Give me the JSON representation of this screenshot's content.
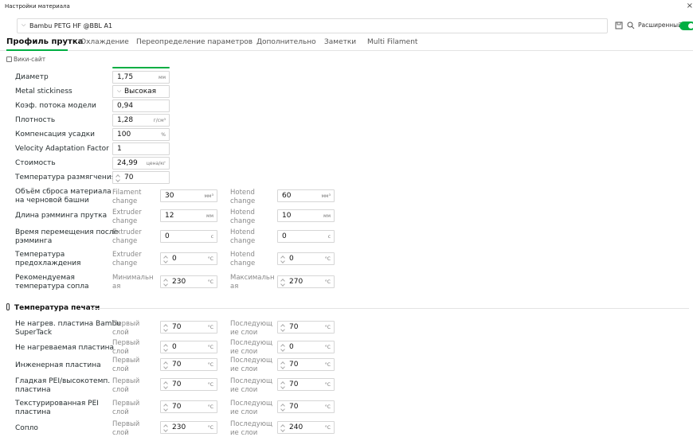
{
  "window": {
    "title": "Настройки материала",
    "close": "×"
  },
  "preset": {
    "name": "Bambu PETG HF @BBL A1",
    "chevron": "⌵"
  },
  "toolbar": {
    "save_icon": "save-icon",
    "search_icon": "search-icon",
    "advanced_label": "Расширенный",
    "advanced_on": true,
    "accent": "#00ae42"
  },
  "tabs": [
    {
      "label": "Профиль прутка",
      "active": true
    },
    {
      "label": "Охлаждение"
    },
    {
      "label": "Переопределение параметров"
    },
    {
      "label": "Дополнительно"
    },
    {
      "label": "Заметки"
    },
    {
      "label": "Multi Filament"
    }
  ],
  "wiki": "Вики-сайт",
  "basic": {
    "diameter": {
      "label": "Диаметр",
      "value": "1,75",
      "unit": "мм"
    },
    "stickiness": {
      "label": "Metal stickiness",
      "value": "Высокая"
    },
    "flow": {
      "label": "Коэф. потока модели",
      "value": "0,94"
    },
    "density": {
      "label": "Плотность",
      "value": "1,28",
      "unit": "г/см³"
    },
    "shrink": {
      "label": "Компенсация усадки",
      "value": "100",
      "unit": "%"
    },
    "velocity": {
      "label": "Velocity Adaptation Factor",
      "value": "1"
    },
    "cost": {
      "label": "Стоимость",
      "value": "24,99",
      "unit": "цена/кг"
    },
    "soften": {
      "label": "Температура размягчения",
      "value": "70"
    }
  },
  "changes": {
    "purge": {
      "label1": "Объём сброса материала",
      "label2": "на черновой башни",
      "sub1a": "Filament",
      "sub1b": "change",
      "value1": "30",
      "unit1": "мм³",
      "sub2a": "Hotend",
      "sub2b": "change",
      "value2": "60",
      "unit2": "мм³"
    },
    "ram_len": {
      "label": "Длина рэмминга прутка",
      "sub1a": "Extruder",
      "sub1b": "change",
      "value1": "12",
      "unit1": "мм",
      "sub2a": "Hotend",
      "sub2b": "change",
      "value2": "10",
      "unit2": "мм"
    },
    "ram_time": {
      "label1": "Время перемещения после",
      "label2": "рэмминга",
      "sub1a": "Extruder",
      "sub1b": "change",
      "value1": "0",
      "unit1": "с",
      "sub2a": "Hotend",
      "sub2b": "change",
      "value2": "0",
      "unit2": "с"
    },
    "precool": {
      "label1": "Температура",
      "label2": "предохлаждения",
      "sub1a": "Extruder",
      "sub1b": "change",
      "value1": "0",
      "unit1": "°C",
      "sub2a": "Hotend",
      "sub2b": "change",
      "value2": "0",
      "unit2": "°C"
    },
    "nozzle_rec": {
      "label1": "Рекомендуемая",
      "label2": "температура сопла",
      "sub1a": "Минимальн",
      "sub1b": "ая",
      "value1": "230",
      "unit1": "°C",
      "sub2a": "Максимальн",
      "sub2b": "ая",
      "value2": "270",
      "unit2": "°C"
    }
  },
  "print_temp": {
    "title": "Температура печати",
    "sub_first_a": "Первый",
    "sub_first_b": "слой",
    "sub_next_a": "Последующ",
    "sub_next_b": "ие слои",
    "unit": "°C",
    "rows": [
      {
        "label1": "Не нагрев. пластина Bambu",
        "label2": "SuperTack",
        "first": "70",
        "next": "70"
      },
      {
        "label1": "Не нагреваемая пластина",
        "label2": "",
        "first": "0",
        "next": "0"
      },
      {
        "label1": "Инженерная пластина",
        "label2": "",
        "first": "70",
        "next": "70"
      },
      {
        "label1": "Гладкая PEI/высокотемп.",
        "label2": "пластина",
        "first": "70",
        "next": "70"
      },
      {
        "label1": "Текстурированная PEI",
        "label2": "пластина",
        "first": "70",
        "next": "70"
      },
      {
        "label1": "Сопло",
        "label2": "",
        "first": "230",
        "next": "240"
      }
    ]
  }
}
